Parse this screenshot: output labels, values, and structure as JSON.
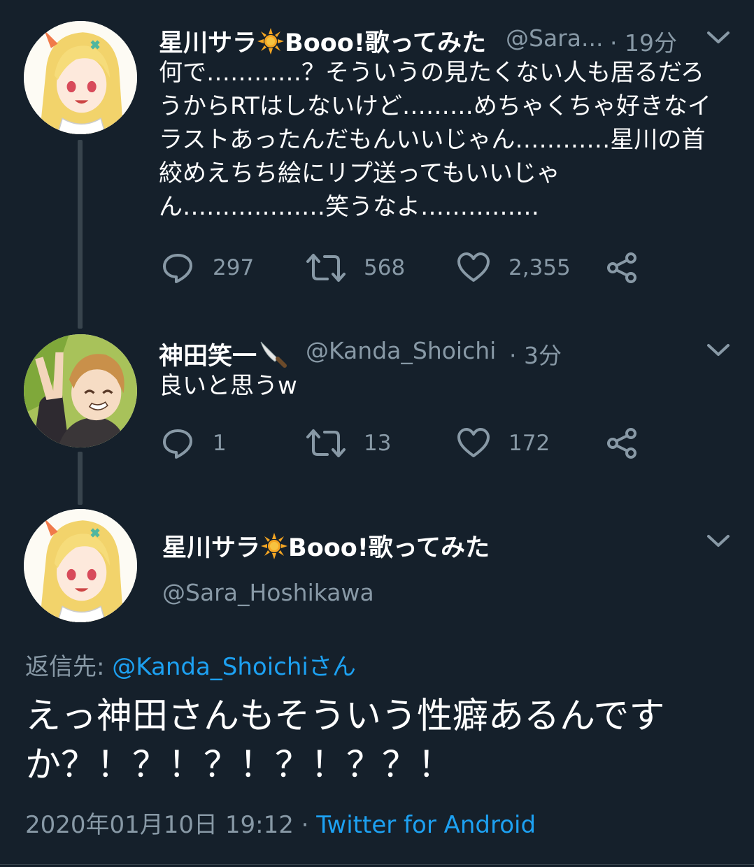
{
  "tweet1": {
    "name": "星川サラ",
    "name_suffix": "Booo!歌ってみた",
    "handle": "@Sara...",
    "time": "· 19分",
    "text": "何で…………？そういうの見たくない人も居るだろうからRTはしないけど………めちゃくちゃ好きなイラストあったんだもんいいじゃん…………星川の首絞めえちち絵にリプ送ってもいいじゃん………………笑うなよ……………",
    "replies": "297",
    "retweets": "568",
    "likes": "2,355"
  },
  "tweet2": {
    "name": "神田笑一",
    "handle": "@Kanda_Shoichi",
    "time": "· 3分",
    "text": "良いと思うw",
    "replies": "1",
    "retweets": "13",
    "likes": "172"
  },
  "main_tweet": {
    "name": "星川サラ",
    "name_suffix": "Booo!歌ってみた",
    "handle": "@Sara_Hoshikawa",
    "reply_to_label": "返信先:",
    "reply_to_user": "@Kanda_Shoichiさん",
    "text": "えっ神田さんもそういう性癖あるんですか？！？！？！？！？？！",
    "timestamp": "2020年01月10日 19:12 ·",
    "source": "Twitter for Android"
  },
  "icons": {
    "reply": "reply-bubble-icon",
    "retweet": "retweet-icon",
    "like": "heart-icon",
    "share": "share-icon",
    "menu": "chevron-down-icon",
    "sun_emoji": "sun-emoji-icon",
    "knife_emoji": "knife-emoji-icon"
  },
  "colors": {
    "background": "#15202b",
    "text": "#ffffff",
    "secondary": "#8899a6",
    "accent": "#1da1f2",
    "thread_line": "#38444d"
  }
}
